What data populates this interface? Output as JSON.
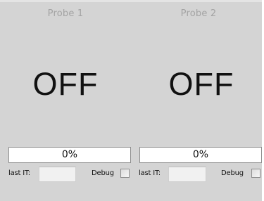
{
  "probes": [
    {
      "title": "Probe 1",
      "state": "OFF",
      "progress": {
        "value": 0,
        "label": "0%"
      },
      "last_it": {
        "label": "last IT:",
        "value": ""
      },
      "debug": {
        "label": "Debug",
        "checked": false
      }
    },
    {
      "title": "Probe 2",
      "state": "OFF",
      "progress": {
        "value": 0,
        "label": "0%"
      },
      "last_it": {
        "label": "last IT:",
        "value": ""
      },
      "debug": {
        "label": "Debug",
        "checked": false
      }
    }
  ],
  "colors": {
    "panel_background": "#d4d4d4",
    "title_text": "#a3a3a3",
    "state_text": "#111111",
    "progress_fill": "#3c8f3c"
  }
}
